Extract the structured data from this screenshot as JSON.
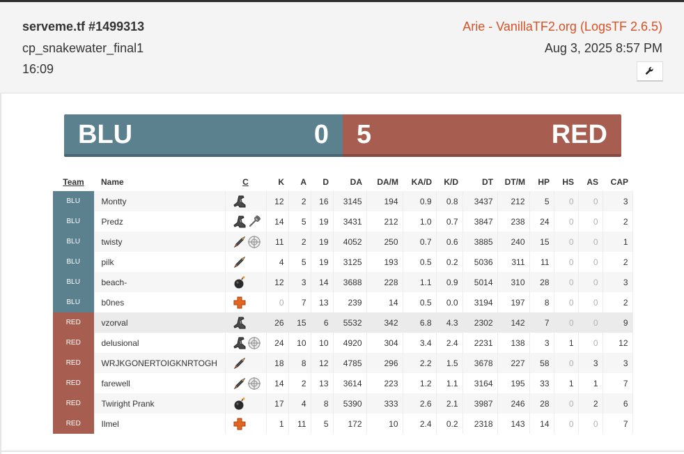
{
  "header": {
    "title": "serveme.tf #1499313",
    "map": "cp_snakewater_final1",
    "duration": "16:09",
    "uploader": "Arie - VanillaTF2.org (LogsTF 2.6.5)",
    "date": "Aug 3, 2025 8:57 PM",
    "tools_icon": "wrench-icon"
  },
  "score": {
    "blu_label": "BLU",
    "blu_score": "0",
    "red_score": "5",
    "red_label": "RED",
    "blu_color": "#5b818f",
    "red_color": "#a75d50"
  },
  "columns": [
    "Team",
    "Name",
    "C",
    "K",
    "A",
    "D",
    "DA",
    "DA/M",
    "KA/D",
    "K/D",
    "DT",
    "DT/M",
    "HP",
    "HS",
    "AS",
    "CAP"
  ],
  "players": [
    {
      "team": "BLU",
      "name": "Montty",
      "classes": [
        "scout"
      ],
      "k": "12",
      "a": "2",
      "d": "16",
      "da": "3145",
      "dam": "194",
      "kad": "0.9",
      "kd": "0.8",
      "dt": "3437",
      "dtm": "212",
      "hp": "5",
      "hs": "0",
      "as": "0",
      "cap": "3"
    },
    {
      "team": "BLU",
      "name": "Predz",
      "classes": [
        "scout",
        "engineer"
      ],
      "k": "14",
      "a": "5",
      "d": "19",
      "da": "3431",
      "dam": "212",
      "kad": "1.0",
      "kd": "0.7",
      "dt": "3847",
      "dtm": "238",
      "hp": "24",
      "hs": "0",
      "as": "0",
      "cap": "2"
    },
    {
      "team": "BLU",
      "name": "twisty",
      "classes": [
        "soldier",
        "sniper"
      ],
      "k": "11",
      "a": "2",
      "d": "19",
      "da": "4052",
      "dam": "250",
      "kad": "0.7",
      "kd": "0.6",
      "dt": "3885",
      "dtm": "240",
      "hp": "15",
      "hs": "0",
      "as": "0",
      "cap": "1"
    },
    {
      "team": "BLU",
      "name": "pilk",
      "classes": [
        "soldier"
      ],
      "k": "4",
      "a": "5",
      "d": "19",
      "da": "3125",
      "dam": "193",
      "kad": "0.5",
      "kd": "0.2",
      "dt": "5036",
      "dtm": "311",
      "hp": "11",
      "hs": "0",
      "as": "0",
      "cap": "2"
    },
    {
      "team": "BLU",
      "name": "beach-",
      "classes": [
        "demoman"
      ],
      "k": "12",
      "a": "3",
      "d": "14",
      "da": "3688",
      "dam": "228",
      "kad": "1.1",
      "kd": "0.9",
      "dt": "5014",
      "dtm": "310",
      "hp": "28",
      "hs": "0",
      "as": "0",
      "cap": "3"
    },
    {
      "team": "BLU",
      "name": "b0nes",
      "classes": [
        "medic"
      ],
      "k": "0",
      "a": "7",
      "d": "13",
      "da": "239",
      "dam": "14",
      "kad": "0.5",
      "kd": "0.0",
      "dt": "3194",
      "dtm": "197",
      "hp": "8",
      "hs": "0",
      "as": "0",
      "cap": "2"
    },
    {
      "team": "RED",
      "name": "vzorval",
      "classes": [
        "scout"
      ],
      "k": "26",
      "a": "15",
      "d": "6",
      "da": "5532",
      "dam": "342",
      "kad": "6.8",
      "kd": "4.3",
      "dt": "2302",
      "dtm": "142",
      "hp": "7",
      "hs": "0",
      "as": "0",
      "cap": "9"
    },
    {
      "team": "RED",
      "name": "delusional",
      "classes": [
        "scout",
        "sniper"
      ],
      "k": "24",
      "a": "10",
      "d": "10",
      "da": "4920",
      "dam": "304",
      "kad": "3.4",
      "kd": "2.4",
      "dt": "2231",
      "dtm": "138",
      "hp": "3",
      "hs": "1",
      "as": "0",
      "cap": "12"
    },
    {
      "team": "RED",
      "name": "WRJKGONERTOIGKNRTOGH",
      "classes": [
        "soldier"
      ],
      "k": "18",
      "a": "8",
      "d": "12",
      "da": "4785",
      "dam": "296",
      "kad": "2.2",
      "kd": "1.5",
      "dt": "3678",
      "dtm": "227",
      "hp": "58",
      "hs": "0",
      "as": "3",
      "cap": "3"
    },
    {
      "team": "RED",
      "name": "farewell",
      "classes": [
        "soldier",
        "sniper"
      ],
      "k": "14",
      "a": "2",
      "d": "13",
      "da": "3614",
      "dam": "223",
      "kad": "1.2",
      "kd": "1.1",
      "dt": "3164",
      "dtm": "195",
      "hp": "33",
      "hs": "1",
      "as": "1",
      "cap": "7"
    },
    {
      "team": "RED",
      "name": "Twiright Prank",
      "classes": [
        "demoman"
      ],
      "k": "17",
      "a": "4",
      "d": "8",
      "da": "5390",
      "dam": "333",
      "kad": "2.6",
      "kd": "2.1",
      "dt": "3987",
      "dtm": "246",
      "hp": "28",
      "hs": "0",
      "as": "2",
      "cap": "6"
    },
    {
      "team": "RED",
      "name": "Ilmel",
      "classes": [
        "medic"
      ],
      "k": "1",
      "a": "11",
      "d": "5",
      "da": "172",
      "dam": "10",
      "kad": "2.4",
      "kd": "0.2",
      "dt": "2318",
      "dtm": "143",
      "hp": "14",
      "hs": "0",
      "as": "0",
      "cap": "7"
    }
  ]
}
